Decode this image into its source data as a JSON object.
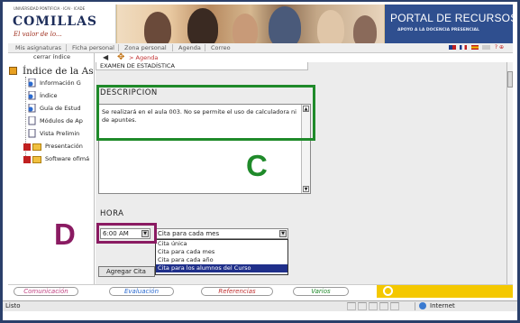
{
  "header": {
    "logo_small_text": "UNIVERSIDAD PONTIFICIA · ICAI · ICADE",
    "logo_name": "COMILLAS",
    "logo_motto": "El valor de lo...",
    "portal_title": "PORTAL DE RECURSOS",
    "portal_subtitle": "APOYO A LA DOCENCIA PRESENCIAL"
  },
  "nav": {
    "items": [
      "Mis asignaturas",
      "Ficha personal",
      "Zona personal",
      "Agenda",
      "Correo"
    ],
    "extra": "? ⊕"
  },
  "sidebar": {
    "cerrar": "cerrar índice",
    "title": "Índice de la As",
    "items": [
      "Información G",
      "Índice",
      "Guía de Estud",
      "Módulos de Ap",
      "Vista Prelimin"
    ],
    "folders": [
      "Presentación",
      "Software ofimá"
    ]
  },
  "backbar": {
    "arrow": "◀",
    "label": "> Agenda"
  },
  "form": {
    "exam_title": "EXAMEN DE ESTADÍSTICA",
    "description_label": "DESCRIPCION",
    "description_text": "Se realizará en el aula 003. No se permite el uso de calculadora ni de apuntes.",
    "hour_label": "HORA",
    "time_value": "6:00 AM",
    "repeat_value": "Cita para cada mes",
    "repeat_options": [
      "Cita única",
      "Cita para cada mes",
      "Cita para cada año",
      "Cita para los alumnos del Curso"
    ],
    "add_button": "Agregar Cita"
  },
  "tabs": [
    "Comunicación",
    "Evaluación",
    "Referencias",
    "Varios"
  ],
  "status": {
    "left": "Listo",
    "zone": "Internet"
  },
  "annotations": {
    "c": "C",
    "d": "D"
  },
  "colors": {
    "portal_blue": "#2f4f8f",
    "annotation_green": "#1f8a2a",
    "annotation_purple": "#8a1b62",
    "tab_yellow": "#f4c800"
  }
}
